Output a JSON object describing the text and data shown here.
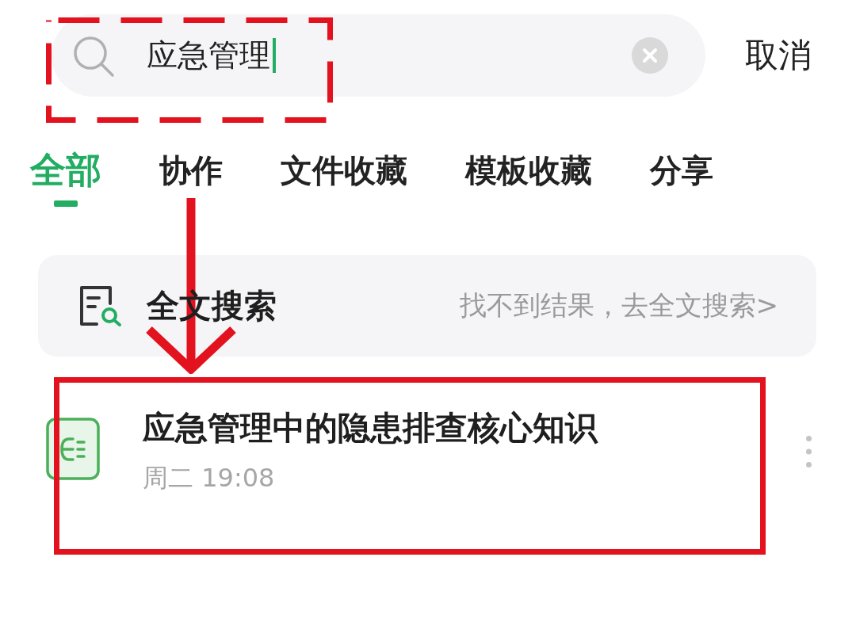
{
  "search": {
    "value": "应急管理",
    "focused": true,
    "highlighted": true
  },
  "cancel": "取消",
  "tabs": [
    {
      "label": "全部",
      "selected": true
    },
    {
      "label": "协作",
      "selected": false
    },
    {
      "label": "文件收藏",
      "selected": false
    },
    {
      "label": "模板收藏",
      "selected": false
    },
    {
      "label": "分享",
      "selected": false
    }
  ],
  "annotation_arrow": true,
  "full_text_search": {
    "title": "全文搜索",
    "hint": "找不到结果，去全文搜索>"
  },
  "results": [
    {
      "title": "应急管理中的隐患排查核心知识",
      "time": "周二 19:08",
      "highlighted": true
    }
  ]
}
